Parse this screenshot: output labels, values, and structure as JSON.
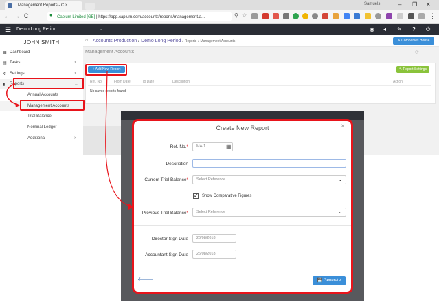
{
  "browser": {
    "tab_title": "Management Reports - C",
    "tab_close": "×",
    "window_user": "Samuels",
    "window_controls": [
      "–",
      "❐",
      "✕"
    ],
    "secure_label": "Capium Limited [GB]",
    "url": "https://app.capium.com/accounts/reports/management.a...",
    "nav_icons": [
      "←",
      "→",
      "C"
    ],
    "menu": "⋮"
  },
  "navbar": {
    "period": "Demo Long Period",
    "companies_house": "Companies House"
  },
  "sidebar": {
    "user": "JOHN SMITH",
    "items": [
      {
        "label": "Dashboard"
      },
      {
        "label": "Tasks"
      },
      {
        "label": "Settings"
      },
      {
        "label": "Reports"
      }
    ],
    "sub_items": [
      {
        "label": "Annual Accounts"
      },
      {
        "label": "Management Accounts"
      },
      {
        "label": "Trial Balance"
      },
      {
        "label": "Nominal Ledger"
      },
      {
        "label": "Additional"
      }
    ]
  },
  "breadcrumb": {
    "part1": "Accounts Production",
    "sep": "/",
    "part2": "Demo Long Period",
    "part3": "Reports",
    "part4": "Management Accounts"
  },
  "page": {
    "title": "Management Accounts",
    "add_button": "+ Add New Report",
    "settings_button": "Report Settings",
    "columns": [
      "Ref. No.",
      "From Date",
      "To Date",
      "Description",
      "Action"
    ],
    "empty_text": "No saved reports found."
  },
  "modal": {
    "title": "Create New Report",
    "close": "×",
    "ref_label": "Ref. No.",
    "ref_value": "MA-1",
    "desc_label": "Description",
    "desc_value": "",
    "ctb_label": "Current Trial Balance",
    "ctb_placeholder": "Select Reference",
    "show_comparative": "Show Comparative Figures",
    "show_comparative_checked": true,
    "ptb_label": "Previous Trial Balance",
    "ptb_placeholder": "Select Reference",
    "director_label": "Director Sign Date",
    "director_value": "26/08/2018",
    "accountant_label": "Accountant Sign Date",
    "accountant_value": "26/08/2018",
    "generate": "Generate"
  },
  "colors": {
    "highlight": "#e8141b",
    "primary": "#3b8fd9",
    "success": "#8ac33b",
    "navbar": "#2a2d35"
  }
}
